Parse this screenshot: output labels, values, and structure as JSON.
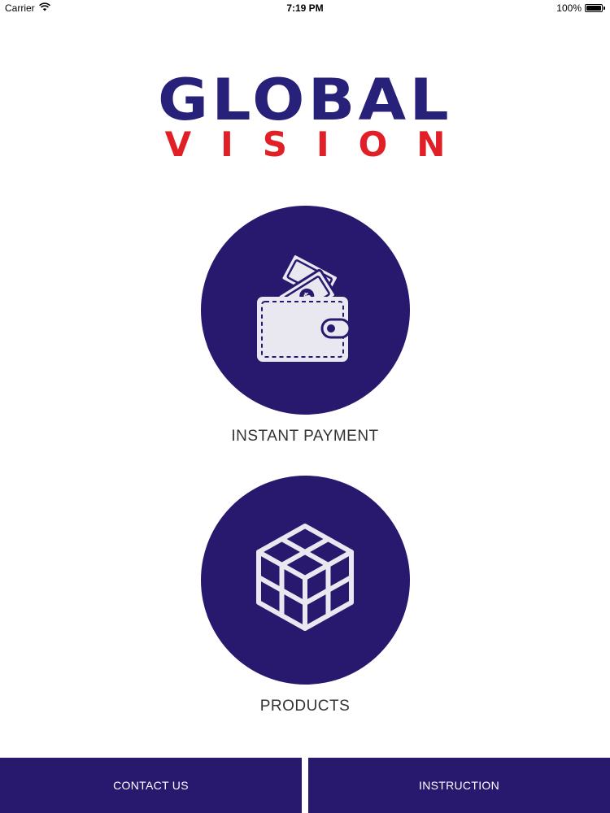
{
  "status_bar": {
    "carrier": "Carrier",
    "time": "7:19 PM",
    "battery": "100%",
    "battery_level": 1.0
  },
  "logo": {
    "line1": "GLOBAL",
    "line2": "VISION",
    "colors": {
      "primary": "#28217a",
      "secondary": "#e01f26"
    }
  },
  "menu": {
    "items": [
      {
        "label": "INSTANT PAYMENT",
        "icon": "wallet-icon"
      },
      {
        "label": "PRODUCTS",
        "icon": "cube-icon"
      }
    ]
  },
  "bottom_bar": {
    "contact_label": "CONTACT US",
    "instruction_label": "INSTRUCTION"
  },
  "theme": {
    "accent": "#28196e",
    "background": "#ffffff",
    "icon_fill": "#e9e8f0"
  }
}
